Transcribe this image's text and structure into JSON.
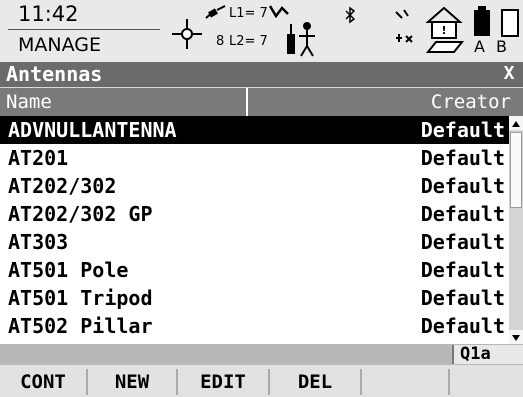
{
  "status": {
    "time": "11:42",
    "mode": "MANAGE",
    "sat_count": "8",
    "l1": "L1= 7",
    "l2": "L2= 7",
    "battery_labels": "A B",
    "icons": [
      "gps-crosshair-icon",
      "satellite-icon",
      "antenna-signal-icon",
      "bluetooth-icon",
      "radio-icon",
      "house-memory-icon",
      "battery-icon"
    ]
  },
  "window": {
    "title": "Antennas",
    "close_label": "X"
  },
  "table": {
    "columns": [
      "Name",
      "Creator"
    ],
    "rows": [
      {
        "name": "ADVNULLANTENNA",
        "creator": "Default",
        "selected": true
      },
      {
        "name": "AT201",
        "creator": "Default"
      },
      {
        "name": "AT202/302",
        "creator": "Default"
      },
      {
        "name": "AT202/302 GP",
        "creator": "Default"
      },
      {
        "name": "AT303",
        "creator": "Default"
      },
      {
        "name": "AT501 Pole",
        "creator": "Default"
      },
      {
        "name": "AT501 Tripod",
        "creator": "Default"
      },
      {
        "name": "AT502 Pillar",
        "creator": "Default"
      }
    ]
  },
  "input_indicator": "Q1a",
  "softkeys": [
    "CONT",
    "NEW",
    "EDIT",
    "DEL",
    "",
    ""
  ]
}
